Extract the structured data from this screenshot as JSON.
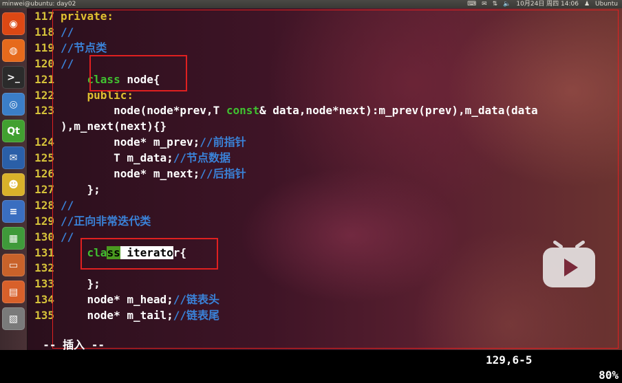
{
  "topbar": {
    "title": "minwei@ubuntu: day02",
    "clock": "10月24日 周四 14:06",
    "user": "Ubuntu"
  },
  "launcher": {
    "items": [
      {
        "name": "ubuntu-logo-icon",
        "glyph": "◉",
        "color": "#dd4814"
      },
      {
        "name": "firefox-icon",
        "glyph": "◍",
        "color": "#e66a1c"
      },
      {
        "name": "terminal-icon",
        "glyph": ">_",
        "color": "#2b2b2b"
      },
      {
        "name": "chromium-icon",
        "glyph": "◎",
        "color": "#3b7ec8"
      },
      {
        "name": "qt-creator-icon",
        "glyph": "Qt",
        "color": "#41a030"
      },
      {
        "name": "thunderbird-icon",
        "glyph": "✉",
        "color": "#2a5fa8"
      },
      {
        "name": "pidgin-icon",
        "glyph": "☻",
        "color": "#d9b12a"
      },
      {
        "name": "writer-icon",
        "glyph": "≡",
        "color": "#3a6ec0"
      },
      {
        "name": "calc-icon",
        "glyph": "▦",
        "color": "#3f9a3a"
      },
      {
        "name": "impress-icon",
        "glyph": "▭",
        "color": "#c8622a"
      },
      {
        "name": "software-center-icon",
        "glyph": "▤",
        "color": "#d8602a"
      },
      {
        "name": "workspace-switcher-icon",
        "glyph": "▧",
        "color": "#7a7a7a"
      }
    ]
  },
  "editor": {
    "lines": [
      {
        "num": "117",
        "segments": [
          {
            "t": "private:",
            "c": "kw"
          }
        ]
      },
      {
        "num": "118",
        "segments": [
          {
            "t": "//",
            "c": "cm"
          }
        ]
      },
      {
        "num": "119",
        "segments": [
          {
            "t": "//节点类",
            "c": "cm"
          }
        ]
      },
      {
        "num": "120",
        "segments": [
          {
            "t": "//",
            "c": "cm"
          }
        ]
      },
      {
        "num": "121",
        "segments": [
          {
            "t": "    ",
            "c": "tx"
          },
          {
            "t": "class",
            "c": "ty"
          },
          {
            "t": " node{",
            "c": "tx"
          }
        ]
      },
      {
        "num": "122",
        "segments": [
          {
            "t": "    ",
            "c": "tx"
          },
          {
            "t": "public:",
            "c": "kw"
          }
        ]
      },
      {
        "num": "123",
        "segments": [
          {
            "t": "        node(node*prev,",
            "c": "tx"
          },
          {
            "t": "T ",
            "c": "tx"
          },
          {
            "t": "const",
            "c": "ty"
          },
          {
            "t": "& data,node*next):m_prev(prev),m_data(data",
            "c": "tx"
          }
        ]
      },
      {
        "num": "",
        "segments": [
          {
            "t": "),m_next(next){}",
            "c": "tx"
          }
        ]
      },
      {
        "num": "124",
        "segments": [
          {
            "t": "        node* m_prev;",
            "c": "tx"
          },
          {
            "t": "//前指针",
            "c": "cm"
          }
        ]
      },
      {
        "num": "125",
        "segments": [
          {
            "t": "        T m_data;",
            "c": "tx"
          },
          {
            "t": "//节点数据",
            "c": "cm"
          }
        ]
      },
      {
        "num": "126",
        "segments": [
          {
            "t": "        node* m_next;",
            "c": "tx"
          },
          {
            "t": "//后指针",
            "c": "cm"
          }
        ]
      },
      {
        "num": "127",
        "segments": [
          {
            "t": "    };",
            "c": "tx"
          }
        ]
      },
      {
        "num": "128",
        "segments": [
          {
            "t": "//",
            "c": "cm"
          }
        ]
      },
      {
        "num": "129",
        "segments": [
          {
            "t": "//正向非常迭代类",
            "c": "cm"
          }
        ]
      },
      {
        "num": "130",
        "segments": [
          {
            "t": "//",
            "c": "cm"
          }
        ]
      },
      {
        "num": "131",
        "segments": [
          {
            "t": "    ",
            "c": "tx"
          },
          {
            "t": "cla",
            "c": "ty"
          },
          {
            "t": "ss",
            "c": "hlg"
          },
          {
            "t": " iterato",
            "c": "hl"
          },
          {
            "t": "r{",
            "c": "tx"
          }
        ]
      },
      {
        "num": "132",
        "segments": []
      },
      {
        "num": "133",
        "segments": [
          {
            "t": "    };",
            "c": "tx"
          }
        ]
      },
      {
        "num": "134",
        "segments": [
          {
            "t": "    node* m_head;",
            "c": "tx"
          },
          {
            "t": "//链表头",
            "c": "cm"
          }
        ]
      },
      {
        "num": "135",
        "segments": [
          {
            "t": "    node* m_tail;",
            "c": "tx"
          },
          {
            "t": "//链表尾",
            "c": "cm"
          }
        ]
      }
    ]
  },
  "status": {
    "mode": "-- 插入 --",
    "position": "129,6-5",
    "percent": "80%"
  }
}
